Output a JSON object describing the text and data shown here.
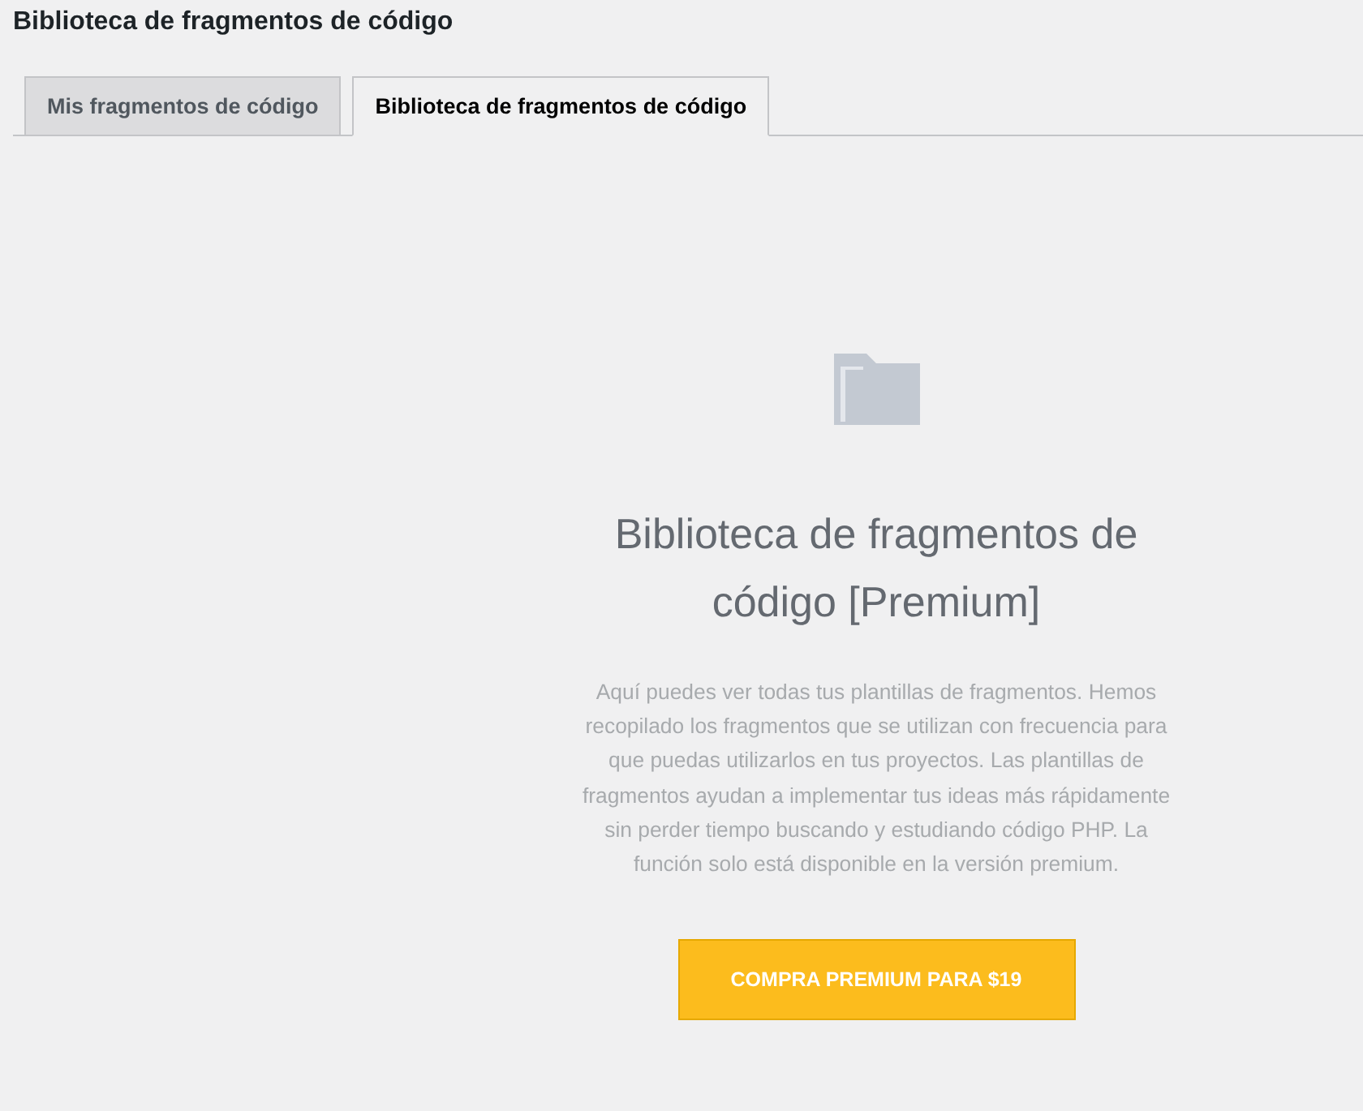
{
  "page_title": "Biblioteca de fragmentos de código",
  "tabs": [
    {
      "label": "Mis fragmentos de código",
      "selected": false
    },
    {
      "label": "Biblioteca de fragmentos de código",
      "selected": true
    }
  ],
  "empty_state": {
    "heading": "Biblioteca de fragmentos de código [Premium]",
    "description": "Aquí puedes ver todas tus plantillas de fragmentos. Hemos recopilado los fragmentos que se utilizan con frecuencia para que puedas utilizarlos en tus proyectos. Las plantillas de fragmentos ayudan a implementar tus ideas más rápidamente sin perder tiempo buscando y estudiando código PHP. La función solo está disponible en la versión premium.",
    "button": "COMPRA PREMIUM PARA $19"
  }
}
